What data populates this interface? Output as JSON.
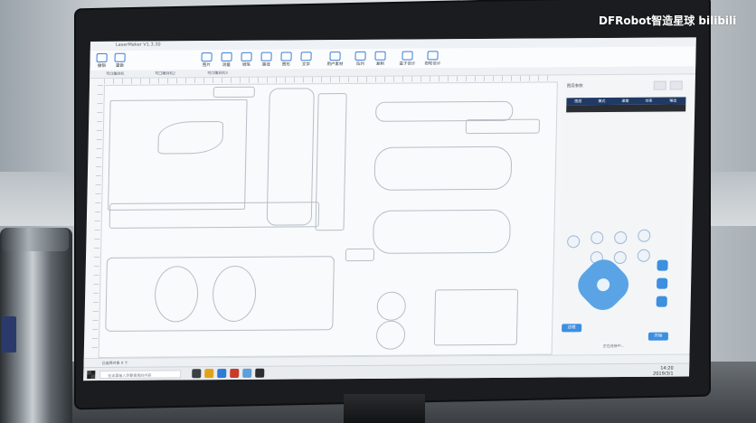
{
  "watermark": {
    "text": "DFRobot智造星球 bilibili"
  },
  "app": {
    "title": "LaserMaker V1.3.30",
    "toolbar": [
      {
        "label": "撤销"
      },
      {
        "label": "重做"
      },
      {
        "label": "图片"
      },
      {
        "label": "测量"
      },
      {
        "label": "钢笔"
      },
      {
        "label": "路径"
      },
      {
        "label": "图形"
      },
      {
        "label": "文字"
      },
      {
        "label": "用户素材"
      },
      {
        "label": "阵列"
      },
      {
        "label": "复制"
      },
      {
        "label": "盒子设计"
      },
      {
        "label": "齿轮设计"
      }
    ],
    "tabs": [
      {
        "label": "可口雕刻机"
      },
      {
        "label": "可口雕刻机2"
      },
      {
        "label": "可口雕刻机3"
      }
    ],
    "layer_panel": {
      "title": "图层参数",
      "columns": [
        "图层",
        "模式",
        "速度",
        "功率",
        "输出"
      ]
    },
    "control": {
      "frame_label": "边框",
      "start_label": "开始",
      "caption": "正在连接中..."
    },
    "status_text": "已选择对象 0 个",
    "taskbar": {
      "search_placeholder": "在这里输入你要搜索的内容",
      "time": "14:20",
      "date": "2019/3/1"
    }
  },
  "colors": {
    "accent": "#3d8fe0",
    "layer_header": "#1f3a66",
    "screen_bg": "#f5f6f8"
  }
}
